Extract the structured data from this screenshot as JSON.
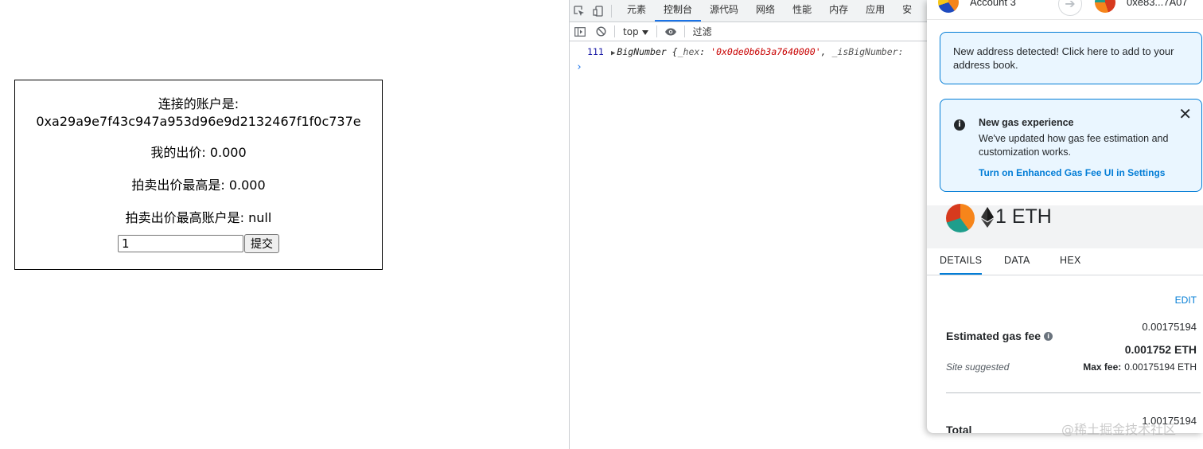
{
  "webpage": {
    "account_label": "连接的账户是:",
    "account_address": "0xa29a9e7f43c947a953d96e9d2132467f1f0c737e",
    "my_bid": "我的出价: 0.000",
    "highest_bid": "拍卖出价最高是: 0.000",
    "highest_bidder": "拍卖出价最高账户是: null",
    "bid_input_value": "1",
    "submit_label": "提交"
  },
  "devtools": {
    "tabs": [
      "元素",
      "控制台",
      "源代码",
      "网络",
      "性能",
      "内存",
      "应用",
      "安"
    ],
    "active_tab": "控制台",
    "context": "top",
    "filter_placeholder": "过滤",
    "console": {
      "line_number": "111",
      "object_prefix": "BigNumber {",
      "hex_key": "_hex",
      "hex_value": "'0x0de0b6b3a7640000'",
      "second_key": "_isBigNumber:"
    }
  },
  "metamask": {
    "account_name": "Account 3",
    "recipient": "0xe83...7A07",
    "address_notice": "New address detected! Click here to add to your address book.",
    "gas_notice": {
      "title": "New gas experience",
      "body": "We've updated how gas fee estimation and customization works.",
      "link": "Turn on Enhanced Gas Fee UI in Settings"
    },
    "amount": "1 ETH",
    "tabs": [
      "DETAILS",
      "DATA",
      "HEX"
    ],
    "edit_label": "EDIT",
    "fee_amount": "0.00175194",
    "estimated_label": "Estimated gas fee",
    "fee_eth": "0.001752 ETH",
    "site_suggested": "Site suggested",
    "max_fee_label": "Max fee:",
    "max_fee_value": "0.00175194 ETH",
    "total_label": "Total",
    "total_value": "1.00175194"
  },
  "watermark": "@稀土掘金技术社区",
  "colors": {
    "accent_blue": "#037dd6",
    "devtools_active": "#1a73e8",
    "string_red": "#c80000"
  }
}
